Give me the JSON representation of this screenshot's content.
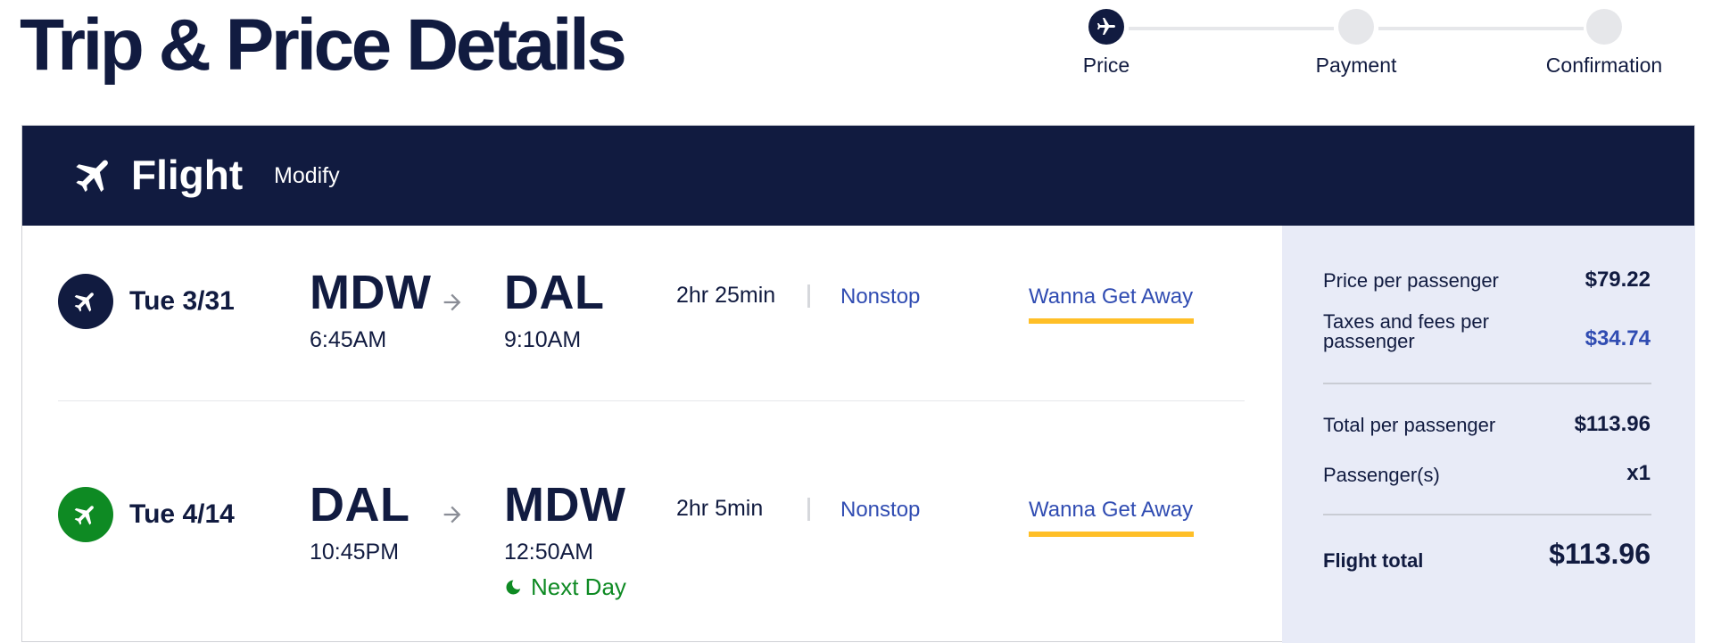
{
  "page": {
    "title": "Trip & Price Details"
  },
  "stepper": {
    "steps": [
      {
        "label": "Price",
        "active": true
      },
      {
        "label": "Payment",
        "active": false
      },
      {
        "label": "Confirmation",
        "active": false
      }
    ]
  },
  "flight_panel": {
    "title": "Flight",
    "modify_label": "Modify",
    "icon": "airplane-icon"
  },
  "flights": [
    {
      "date": "Tue 3/31",
      "icon": "airplane-icon",
      "icon_color": "#111b40",
      "origin": "MDW",
      "depart_time": "6:45AM",
      "destination": "DAL",
      "arrive_time": "9:10AM",
      "duration": "2hr 25min",
      "stops": "Nonstop",
      "fare_class": "Wanna Get Away"
    },
    {
      "date": "Tue 4/14",
      "icon": "airplane-icon",
      "icon_color": "#0e8a23",
      "origin": "DAL",
      "depart_time": "10:45PM",
      "destination": "MDW",
      "arrive_time": "12:50AM",
      "duration": "2hr 5min",
      "stops": "Nonstop",
      "fare_class": "Wanna Get Away",
      "next_day": "Next Day"
    }
  ],
  "price_summary": {
    "price_per_passenger_label": "Price per passenger",
    "price_per_passenger_value": "$79.22",
    "taxes_label_line1": "Taxes and fees per",
    "taxes_label_line2": "passenger",
    "taxes_value": "$34.74",
    "total_per_passenger_label": "Total per passenger",
    "total_per_passenger_value": "$113.96",
    "passengers_label": "Passenger(s)",
    "passengers_value": "x1",
    "flight_total_label": "Flight total",
    "flight_total_value": "$113.96"
  },
  "colors": {
    "navy": "#111b40",
    "link_blue": "#304cb2",
    "accent_yellow": "#ffbf27",
    "success_green": "#0e8a23",
    "summary_bg": "#e8ebf7"
  }
}
